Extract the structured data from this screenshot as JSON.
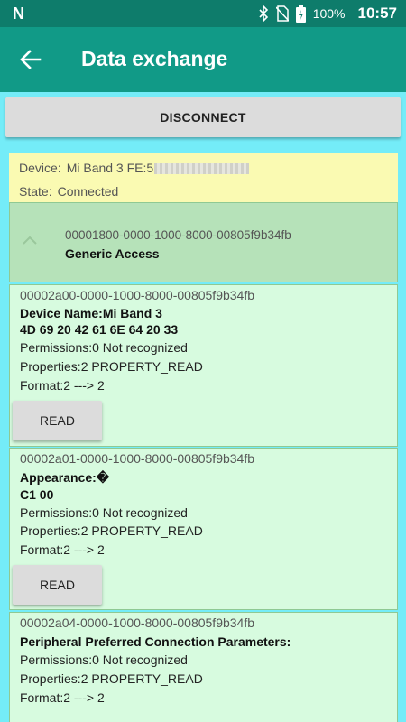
{
  "status_bar": {
    "battery": "100%",
    "time": "10:57"
  },
  "app_bar": {
    "title": "Data exchange"
  },
  "disconnect_label": "DISCONNECT",
  "device": {
    "device_label": "Device:",
    "device_value": "Mi Band 3 FE:5",
    "state_label": "State:",
    "state_value": "Connected"
  },
  "service": {
    "uuid": "00001800-0000-1000-8000-00805f9b34fb",
    "name": "Generic Access"
  },
  "characteristics": [
    {
      "uuid": "00002a00-0000-1000-8000-00805f9b34fb",
      "name": "Device Name:Mi Band 3",
      "value": "4D 69 20 42 61 6E 64 20 33",
      "permissions": "Permissions:0 Not recognized",
      "properties": "Properties:2  PROPERTY_READ",
      "format": "Format:2 ---> 2",
      "button": "READ"
    },
    {
      "uuid": "00002a01-0000-1000-8000-00805f9b34fb",
      "name": "Appearance:�",
      "value": "C1 00",
      "permissions": "Permissions:0 Not recognized",
      "properties": "Properties:2  PROPERTY_READ",
      "format": "Format:2 ---> 2",
      "button": "READ"
    },
    {
      "uuid": "00002a04-0000-1000-8000-00805f9b34fb",
      "name": "Peripheral Preferred Connection Parameters:",
      "permissions": "Permissions:0 Not recognized",
      "properties": "Properties:2  PROPERTY_READ",
      "format": "Format:2 ---> 2"
    }
  ]
}
